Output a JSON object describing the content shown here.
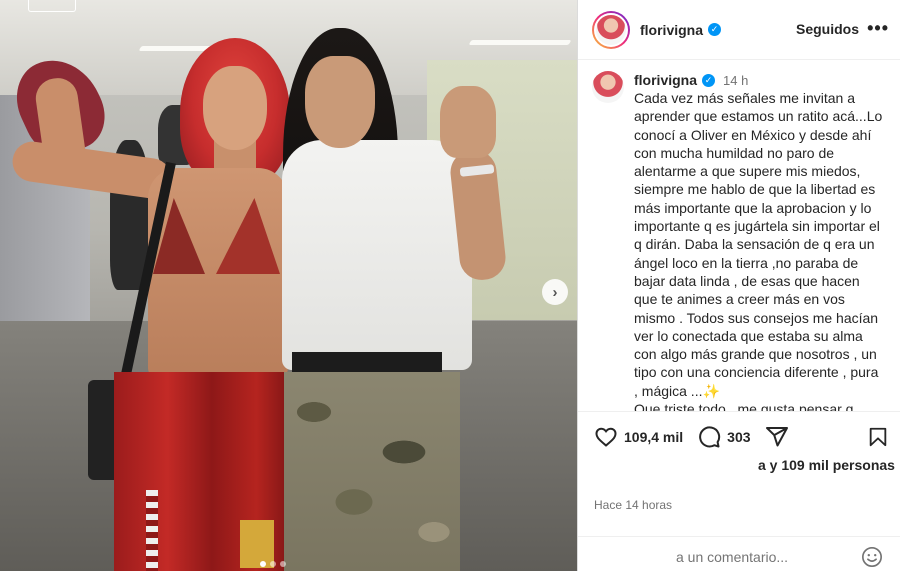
{
  "media": {
    "next_icon": "chevron-right-icon",
    "carousel": {
      "count": 3,
      "active_index": 0
    }
  },
  "header": {
    "username": "florivigna",
    "verified_icon": "verified-badge-icon",
    "follow_label": "Seguidos",
    "more_label": "•••"
  },
  "caption": {
    "username": "florivigna",
    "time": "14 h",
    "text": "Cada vez más señales me invitan a aprender que estamos un ratito acá...Lo conocí a Oliver en México  y desde ahí con mucha humildad no paro de alentarme a que supere mis miedos, siempre me hablo de que la libertad es más importante que la aprobacion y lo importante q es jugártela sin importar el q dirán. Daba la sensación de q era un  ángel loco en la tierra ,no paraba de bajar data linda , de esas que hacen que te animes a creer más en vos mismo . Todos sus consejos me hacían ver lo conectada que estaba su alma con algo más grande que nosotros , un tipo con una conciencia diferente , pura , mágica ...✨\nQue triste todo , me gusta pensar q"
  },
  "actions": {
    "like_icon": "heart-icon",
    "likes": "109,4 mil",
    "comment_icon": "comment-bubble-icon",
    "comments": "303",
    "share_icon": "paper-plane-icon",
    "save_icon": "bookmark-icon",
    "liked_by": "a y 109 mil personas"
  },
  "timestamp": "Hace 14 horas",
  "comment": {
    "placeholder": "a un comentario...",
    "emoji_icon": "smiley-icon"
  },
  "colors": {
    "verified": "#0095f6",
    "text": "#262626",
    "muted": "#737373"
  }
}
